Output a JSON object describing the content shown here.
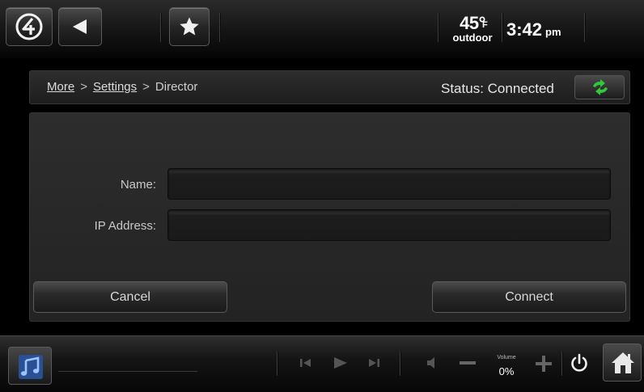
{
  "topbar": {
    "temperature": "45°",
    "temperature_unit": "F",
    "temperature_label": "outdoor",
    "time": "3:42",
    "time_suffix": "pm",
    "icons": [
      "control4-logo-icon",
      "back-arrow-icon",
      "star-icon"
    ]
  },
  "breadcrumb": {
    "items": [
      "More",
      "Settings",
      "Director"
    ],
    "separator": ">"
  },
  "status": {
    "text": "Status: Connected",
    "refresh_icon": "refresh-arrows-icon",
    "icon_color": "#2fc93a"
  },
  "form": {
    "name_label": "Name:",
    "name_value": "",
    "ip_label": "IP Address:",
    "ip_value": "",
    "cancel_label": "Cancel",
    "connect_label": "Connect"
  },
  "bottombar": {
    "volume_label": "Volume",
    "volume_value": "0%",
    "icons": [
      "music-note-icon",
      "skip-previous-icon",
      "play-icon",
      "skip-next-icon",
      "speaker-icon",
      "volume-down-icon",
      "volume-up-icon",
      "power-icon",
      "home-icon"
    ]
  },
  "colors": {
    "accent_green": "#2fc93a",
    "music_icon_blue": "#4f7fd0"
  }
}
